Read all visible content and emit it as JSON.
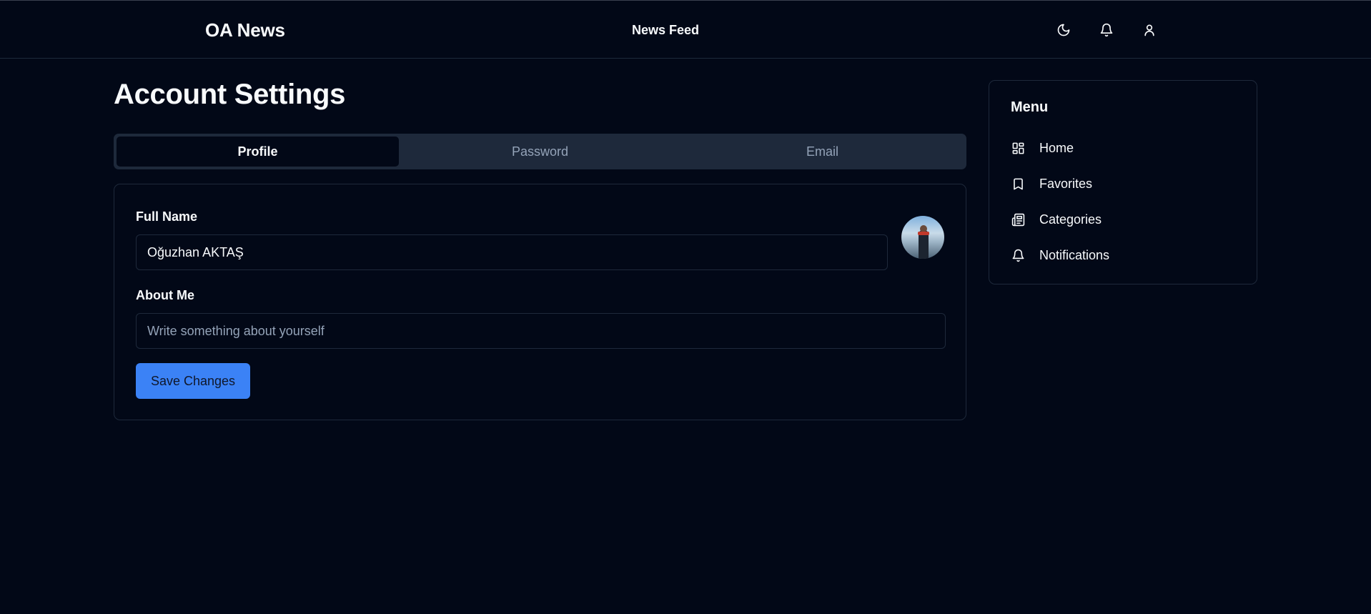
{
  "header": {
    "brand": "OA News",
    "nav_link": "News Feed",
    "icons": [
      "moon-icon",
      "bell-icon",
      "user-icon"
    ]
  },
  "page": {
    "title": "Account Settings"
  },
  "tabs": [
    {
      "label": "Profile",
      "active": true
    },
    {
      "label": "Password",
      "active": false
    },
    {
      "label": "Email",
      "active": false
    }
  ],
  "profile_form": {
    "full_name_label": "Full Name",
    "full_name_value": "Oğuzhan AKTAŞ",
    "about_label": "About Me",
    "about_value": "",
    "about_placeholder": "Write something about yourself",
    "save_label": "Save Changes"
  },
  "menu": {
    "title": "Menu",
    "items": [
      {
        "label": "Home",
        "icon": "dashboard-icon"
      },
      {
        "label": "Favorites",
        "icon": "bookmark-icon"
      },
      {
        "label": "Categories",
        "icon": "newspaper-icon"
      },
      {
        "label": "Notifications",
        "icon": "bell-icon"
      }
    ]
  },
  "colors": {
    "background": "#020817",
    "border": "#1e293b",
    "muted_text": "#94a3b8",
    "accent": "#3b82f6"
  }
}
